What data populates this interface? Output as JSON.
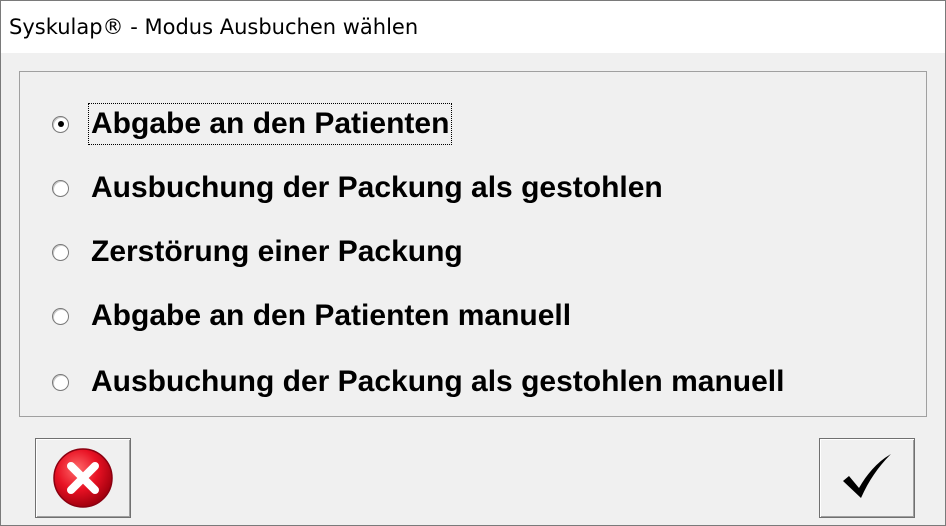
{
  "window": {
    "title": "Syskulap® - Modus Ausbuchen wählen"
  },
  "options": [
    {
      "label": "Abgabe an den Patienten",
      "checked": true
    },
    {
      "label": "Ausbuchung der Packung als gestohlen",
      "checked": false
    },
    {
      "label": "Zerstörung einer Packung",
      "checked": false
    },
    {
      "label": "Abgabe an den Patienten manuell",
      "checked": false
    },
    {
      "label": "Ausbuchung der Packung als gestohlen manuell",
      "checked": false
    }
  ],
  "buttons": {
    "cancel_icon": "cancel-x-icon",
    "ok_icon": "checkmark-icon"
  },
  "colors": {
    "cancel_red": "#e81123",
    "background": "#f0f0f0"
  }
}
